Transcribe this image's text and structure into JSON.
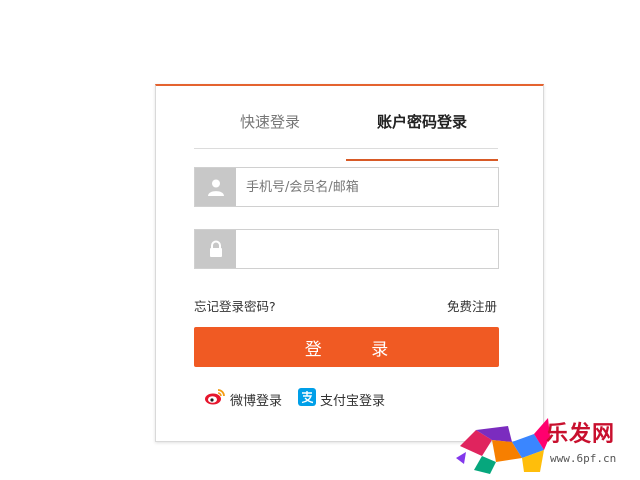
{
  "tabs": [
    {
      "label": "快速登录",
      "active": false
    },
    {
      "label": "账户密码登录",
      "active": true
    }
  ],
  "form": {
    "username_placeholder": "手机号/会员名/邮箱",
    "username_value": "",
    "password_placeholder": "",
    "password_value": ""
  },
  "links": {
    "forgot": "忘记登录密码?",
    "register": "免费注册"
  },
  "login_button": "登 录",
  "third_party": {
    "weibo": "微博登录",
    "alipay": "支付宝登录"
  },
  "watermark": {
    "brand": "乐发网",
    "url": "www.6pf.cn"
  },
  "colors": {
    "accent": "#f05a23",
    "tab_underline": "#d85a26",
    "icon_bg": "#c8c8c8"
  },
  "icons": [
    "user-icon",
    "lock-icon",
    "weibo-icon",
    "alipay-icon"
  ]
}
